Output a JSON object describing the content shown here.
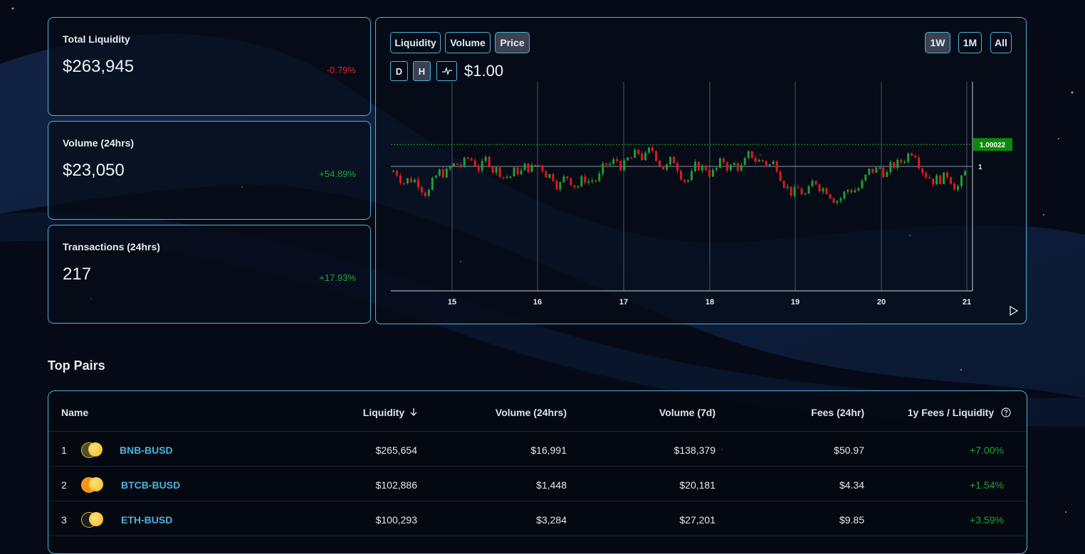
{
  "stats": [
    {
      "label": "Total Liquidity",
      "value": "$263,945",
      "change": "-0.79%",
      "direction": "negative"
    },
    {
      "label": "Volume (24hrs)",
      "value": "$23,050",
      "change": "+54.89%",
      "direction": "positive"
    },
    {
      "label": "Transactions (24hrs)",
      "value": "217",
      "change": "+17.93%",
      "direction": "positive"
    }
  ],
  "chart_controls": {
    "metric_tabs": [
      "Liquidity",
      "Volume",
      "Price"
    ],
    "active_metric": "Price",
    "range_tabs": [
      "1W",
      "1M",
      "All"
    ],
    "active_range": "1W",
    "interval_tabs": [
      "D",
      "H"
    ],
    "active_interval": "H",
    "chart_type_icon": "line-chart-icon",
    "current_price": "$1.00"
  },
  "chart_data": {
    "type": "candlestick",
    "x_tick_labels": [
      "15",
      "16",
      "17",
      "18",
      "19",
      "20",
      "21"
    ],
    "y_tick_labels": [
      "1"
    ],
    "last_price_label": "1.00022",
    "y_range": [
      0.99875,
      1.00085
    ],
    "up_color": "#1e9e35",
    "down_color": "#e0191f",
    "last_price_color": "#0a8a0a"
  },
  "section_title": "Top Pairs",
  "table": {
    "columns": [
      "Name",
      "Liquidity",
      "Volume (24hrs)",
      "Volume (7d)",
      "Fees (24hr)",
      "1y Fees / Liquidity"
    ],
    "sort_column": "Liquidity",
    "sort_icon": "arrow-down-icon",
    "info_icon": "question-circle-icon",
    "rows": [
      {
        "rank": "1",
        "pair": "BNB-BUSD",
        "liquidity": "$265,654",
        "volume_24h": "$16,991",
        "volume_7d": "$138,379",
        "fees_24h": "$50.97",
        "apr": "+7.00%",
        "token0_color": "#4a4f2e",
        "token1_color": "#f0b90b"
      },
      {
        "rank": "2",
        "pair": "BTCB-BUSD",
        "liquidity": "$102,886",
        "volume_24h": "$1,448",
        "volume_7d": "$20,181",
        "fees_24h": "$4.34",
        "apr": "+1.54%",
        "token0_color": "#f7931a",
        "token1_color": "#f0b90b"
      },
      {
        "rank": "3",
        "pair": "ETH-BUSD",
        "liquidity": "$100,293",
        "volume_24h": "$3,284",
        "volume_7d": "$27,201",
        "fees_24h": "$9.85",
        "apr": "+3.59%",
        "token0_color": "#1a1d22",
        "token1_color": "#f0b90b"
      }
    ]
  }
}
